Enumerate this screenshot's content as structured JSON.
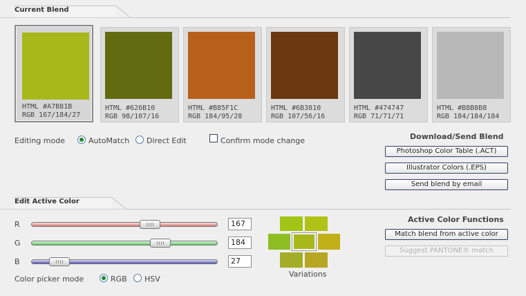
{
  "sections": {
    "current_blend": "Current Blend",
    "edit_active": "Edit Active Color"
  },
  "swatches": [
    {
      "color": "#A7B81B",
      "html": "HTML #A7B81B",
      "rgb": "RGB 167/184/27",
      "active": true
    },
    {
      "color": "#626B10",
      "html": "HTML #626B10",
      "rgb": "RGB 98/107/16"
    },
    {
      "color": "#B85F1C",
      "html": "HTML #B85F1C",
      "rgb": "RGB 184/95/28"
    },
    {
      "color": "#6B3810",
      "html": "HTML #6B3810",
      "rgb": "RGB 107/56/16"
    },
    {
      "color": "#474747",
      "html": "HTML #474747",
      "rgb": "RGB 71/71/71"
    },
    {
      "color": "#B8B8B8",
      "html": "HTML #B8B8B8",
      "rgb": "RGB 184/184/184"
    }
  ],
  "editing_mode": {
    "label": "Editing mode",
    "automatch": "AutoMatch",
    "direct_edit": "Direct Edit",
    "selected": "automatch",
    "confirm": "Confirm mode change",
    "confirm_checked": false
  },
  "download": {
    "heading": "Download/Send Blend",
    "act": "Photoshop Color Table (.ACT)",
    "eps": "Illustrator Colors (.EPS)",
    "email": "Send blend by email"
  },
  "sliders": {
    "r": {
      "label": "R",
      "value": "167",
      "fraction": 0.655
    },
    "g": {
      "label": "G",
      "value": "184",
      "fraction": 0.72
    },
    "b": {
      "label": "B",
      "value": "27",
      "fraction": 0.106
    }
  },
  "picker": {
    "label": "Color picker mode",
    "rgb": "RGB",
    "hsv": "HSV",
    "selected": "rgb"
  },
  "variations": {
    "label": "Variations",
    "colors": {
      "top_left": "#A2C416",
      "top_right": "#B1C216",
      "mid_left": "#8DBE24",
      "center": "#A7B81B",
      "mid_right": "#C1B018",
      "bottom_left": "#A3AE26",
      "bottom_right": "#B7A622"
    }
  },
  "active_functions": {
    "heading": "Active Color Functions",
    "match": "Match blend from active color",
    "pantone": "Suggest PANTONE® match"
  }
}
